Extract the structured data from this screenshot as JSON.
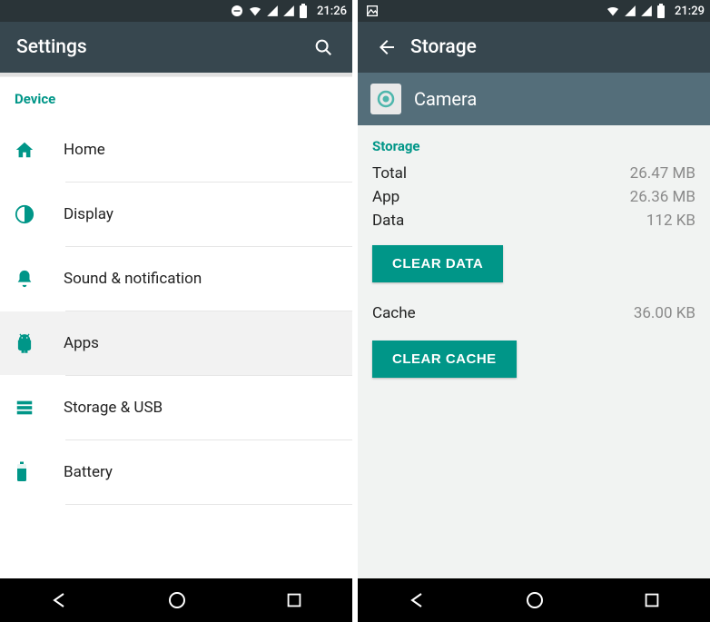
{
  "left": {
    "status": {
      "time": "21:26"
    },
    "title": "Settings",
    "section": "Device",
    "items": [
      {
        "icon": "home",
        "label": "Home"
      },
      {
        "icon": "display",
        "label": "Display"
      },
      {
        "icon": "bell",
        "label": "Sound & notification"
      },
      {
        "icon": "android",
        "label": "Apps",
        "selected": true
      },
      {
        "icon": "storage",
        "label": "Storage & USB"
      },
      {
        "icon": "battery",
        "label": "Battery"
      }
    ]
  },
  "right": {
    "status": {
      "time": "21:29"
    },
    "title": "Storage",
    "app_name": "Camera",
    "section": "Storage",
    "rows": [
      {
        "label": "Total",
        "value": "26.47 MB"
      },
      {
        "label": "App",
        "value": "26.36 MB"
      },
      {
        "label": "Data",
        "value": "112 KB"
      }
    ],
    "clear_data": "CLEAR DATA",
    "cache_row": {
      "label": "Cache",
      "value": "36.00 KB"
    },
    "clear_cache": "CLEAR CACHE"
  }
}
